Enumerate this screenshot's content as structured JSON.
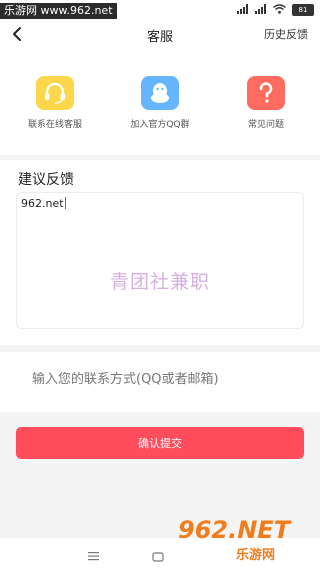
{
  "status_bar": {
    "site_badge": "乐游网 www.962.net",
    "battery": "81"
  },
  "header": {
    "title": "客服",
    "history_link": "历史反馈"
  },
  "quick_actions": [
    {
      "label": "联系在线客服",
      "icon": "headset-icon",
      "color": "#fcd64b"
    },
    {
      "label": "加入官方QQ群",
      "icon": "qq-penguin-icon",
      "color": "#66b6ff"
    },
    {
      "label": "常见问题",
      "icon": "question-icon",
      "color": "#ff6b5f"
    }
  ],
  "feedback": {
    "title": "建议反馈",
    "value": "962.net",
    "watermark": "青团社兼职"
  },
  "contact": {
    "placeholder": "输入您的联系方式(QQ或者邮箱)"
  },
  "submit_label": "确认提交",
  "brand": {
    "logo_text": "962.NET",
    "sub_text": "乐游网"
  },
  "colors": {
    "accent": "#ff4d5e",
    "brand": "#f07c1d"
  }
}
